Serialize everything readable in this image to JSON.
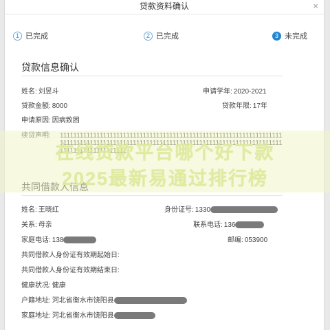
{
  "dialog": {
    "title": "贷款资料确认",
    "close_glyph": "×"
  },
  "steps": [
    {
      "num": "1",
      "label": "已完成"
    },
    {
      "num": "2",
      "label": "已完成"
    },
    {
      "num": "3",
      "label": "未完成"
    }
  ],
  "loan_section": {
    "title": "贷款信息确认",
    "name_label": "姓名:",
    "name_value": "刘昱斗",
    "year_label": "申请学年:",
    "year_value": "2020-2021",
    "amount_label": "贷款金额:",
    "amount_value": "8000",
    "term_label": "贷款年限:",
    "term_value": "17年",
    "reason_label": "申请原因:",
    "reason_value": "因病致困",
    "decl_label": "续贷声明:",
    "decl_value": "1111111111111111111111111111111111111111111111111111111111111111111111111111111111111111111111111111111111111111111111111111111111111111111111111111111111"
  },
  "watermark": {
    "line1": "在线贷款平台哪个好下款",
    "line2": "2025最新易通过排行榜"
  },
  "coborrower_section": {
    "title": "共同借款人信息",
    "name_label": "姓名:",
    "name_value": "王晓红",
    "id_label": "身份证号:",
    "id_value": "1330",
    "relation_label": "关系:",
    "relation_value": "母亲",
    "phone_label": "联系电话:",
    "phone_value": "136",
    "home_phone_label": "家庭电话:",
    "home_phone_value": "138",
    "postcode_label": "邮编:",
    "postcode_value": "053900",
    "id_start_label": "共同借款人身份证有效期起始日:",
    "id_end_label": "共同借款人身份证有效期结束日:",
    "health_label": "健康状况:",
    "health_value": "健康",
    "hukou_label": "户籍地址:",
    "hukou_value": "河北省衡水市饶阳县",
    "home_addr_label": "家庭地址:",
    "home_addr_value": "河北省衡水市饶阳县"
  }
}
